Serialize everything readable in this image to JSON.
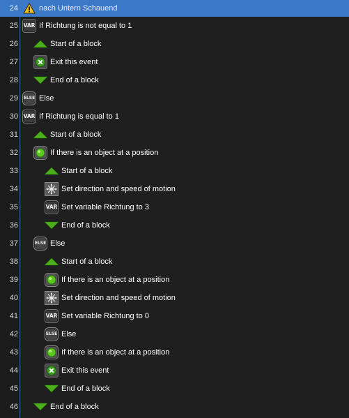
{
  "rows": [
    {
      "line": "24",
      "icon": "warning",
      "label": "nach Untern Schauend",
      "selected": true
    },
    {
      "line": "25",
      "icon": "var",
      "label": "If Richtung is not equal to 1"
    },
    {
      "line": "26",
      "icon": "start-block",
      "label": "Start of a block"
    },
    {
      "line": "27",
      "icon": "exit",
      "label": "Exit this event"
    },
    {
      "line": "28",
      "icon": "end-block",
      "label": "End of a block"
    },
    {
      "line": "29",
      "icon": "else",
      "label": "Else"
    },
    {
      "line": "30",
      "icon": "var",
      "label": "If Richtung is equal to 1"
    },
    {
      "line": "31",
      "icon": "start-block",
      "label": "Start of a block"
    },
    {
      "line": "32",
      "icon": "object",
      "label": "If there is an object at a position"
    },
    {
      "line": "33",
      "icon": "start-block",
      "label": "Start of a block"
    },
    {
      "line": "34",
      "icon": "motion",
      "label": "Set direction and speed of motion"
    },
    {
      "line": "35",
      "icon": "var",
      "label": "Set variable Richtung to 3"
    },
    {
      "line": "36",
      "icon": "end-block",
      "label": "End of a block"
    },
    {
      "line": "37",
      "icon": "else",
      "label": "Else"
    },
    {
      "line": "38",
      "icon": "start-block",
      "label": "Start of a block"
    },
    {
      "line": "39",
      "icon": "object",
      "label": "If there is an object at a position"
    },
    {
      "line": "40",
      "icon": "motion",
      "label": "Set direction and speed of motion"
    },
    {
      "line": "41",
      "icon": "var",
      "label": "Set variable Richtung to 0"
    },
    {
      "line": "42",
      "icon": "else",
      "label": "Else"
    },
    {
      "line": "43",
      "icon": "object",
      "label": "If there is an object at a position"
    },
    {
      "line": "44",
      "icon": "exit",
      "label": "Exit this event"
    },
    {
      "line": "45",
      "icon": "end-block",
      "label": "End of a block"
    },
    {
      "line": "46",
      "icon": "end-block",
      "label": "End of a block"
    }
  ],
  "icon_text": {
    "var": "VAR",
    "else": "ELSE"
  },
  "colors": {
    "selected_row": "#3c78c8",
    "block_arrow": "#4caf1c",
    "background": "#1f1f1f"
  }
}
